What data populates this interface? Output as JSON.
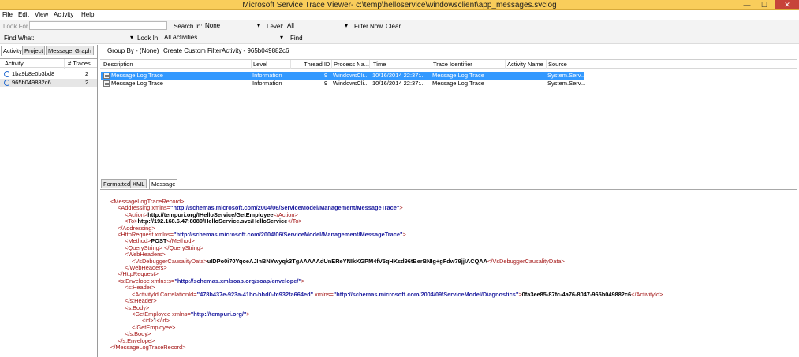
{
  "window": {
    "title": "Microsoft Service Trace Viewer- c:\\temp\\helloservice\\windowsclient\\app_messages.svclog",
    "close": "✕",
    "min": "—",
    "max": "☐"
  },
  "menu": [
    "File",
    "Edit",
    "View",
    "Activity",
    "Help"
  ],
  "toolbar1": {
    "look_for_label": "Look For",
    "look_for_value": "",
    "search_in_label": "Search In:",
    "search_in_value": "None",
    "level_label": "Level:",
    "level_value": "All",
    "filter_now": "Filter Now",
    "clear": "Clear"
  },
  "toolbar2": {
    "find_what_label": "Find What:",
    "find_what_value": "",
    "look_in_label": "Look In:",
    "look_in_value": "All Activities",
    "find": "Find"
  },
  "left": {
    "tabs": [
      "Activity",
      "Project",
      "Message",
      "Graph"
    ],
    "columns": [
      "Activity",
      "# Traces"
    ],
    "rows": [
      {
        "name": "1ba9b8e0b3bd8",
        "count": "2"
      },
      {
        "name": "965b049882c6",
        "count": "2"
      }
    ]
  },
  "right_top": {
    "group_by": "Group By - (None)",
    "create_filter": "Create Custom Filter",
    "activity": "Activity - 965b049882c6",
    "columns": [
      "Description",
      "Level",
      "Thread ID",
      "Process Na...",
      "Time",
      "Trace Identifier",
      "Activity Name",
      "Source"
    ],
    "rows": [
      {
        "desc": "Message Log Trace",
        "level": "Information",
        "thread": "9",
        "process": "WindowsCli...",
        "time": "10/16/2014  22:37:...",
        "trace_id": "Message Log Trace",
        "activity_name": "",
        "source": "System.Serv..."
      },
      {
        "desc": "Message Log Trace",
        "level": "Information",
        "thread": "9",
        "process": "WindowsCli...",
        "time": "10/16/2014  22:37:...",
        "trace_id": "Message Log Trace",
        "activity_name": "",
        "source": "System.Serv..."
      }
    ]
  },
  "right_bottom": {
    "tabs": [
      "Formatted",
      "XML",
      "Message"
    ]
  },
  "xml": {
    "l1": "<MessageLogTraceRecord>",
    "l2_tag": "<Addressing xmlns=",
    "l2_val": "\"http://schemas.microsoft.com/2004/06/ServiceModel/Management/MessageTrace\"",
    "l2_end": ">",
    "l3_open": "<Action>",
    "l3_val": "http://tempuri.org/IHelloService/GetEmployee",
    "l3_close": "</Action>",
    "l4_open": "<To>",
    "l4_val": "http://192.168.6.47:8080/HelloService.svc/HelloService",
    "l4_close": "</To>",
    "l5": "</Addressing>",
    "l6_tag": "<HttpRequest xmlns=",
    "l6_val": "\"http://schemas.microsoft.com/2004/06/ServiceModel/Management/MessageTrace\"",
    "l6_end": ">",
    "l7_open": "<Method>",
    "l7_val": "POST",
    "l7_close": "</Method>",
    "l8": "<QueryString> </QueryString>",
    "l9": "<WebHeaders>",
    "l10_open": "<VsDebuggerCausalityData>",
    "l10_val": "uIDPo0i70YqoeAJIhBNYwyqk3TgAAAAAdUnEReYNIkKGPM4fV5qHKsd96tBerBNIg+gFdw79jjIACQAA",
    "l10_close": "</VsDebuggerCausalityData>",
    "l11": "</WebHeaders>",
    "l12": "</HttpRequest>",
    "l13_tag": "<s:Envelope xmlns:s=",
    "l13_val": "\"http://schemas.xmlsoap.org/soap/envelope/\"",
    "l13_end": ">",
    "l14": "<s:Header>",
    "l15_tag": "<ActivityId CorrelationId=",
    "l15_v1": "\"478b437e-923a-41bc-bbd0-fc932fa664ed\"",
    "l15_attr2": " xmlns=",
    "l15_v2": "\"http://schemas.microsoft.com/2004/09/ServiceModel/Diagnostics\"",
    "l15_end": ">",
    "l15_text": "0fa3ee85-87fc-4a76-8047-965b049882c6",
    "l15_close": "</ActivityId>",
    "l16": "</s:Header>",
    "l17": "<s:Body>",
    "l18_tag": "<GetEmployee xmlns=",
    "l18_val": "\"http://tempuri.org/\"",
    "l18_end": ">",
    "l19_open": "<id>",
    "l19_val": "1",
    "l19_close": "</id>",
    "l20": "</GetEmployee>",
    "l21": "</s:Body>",
    "l22": "</s:Envelope>",
    "l23": "</MessageLogTraceRecord>"
  }
}
